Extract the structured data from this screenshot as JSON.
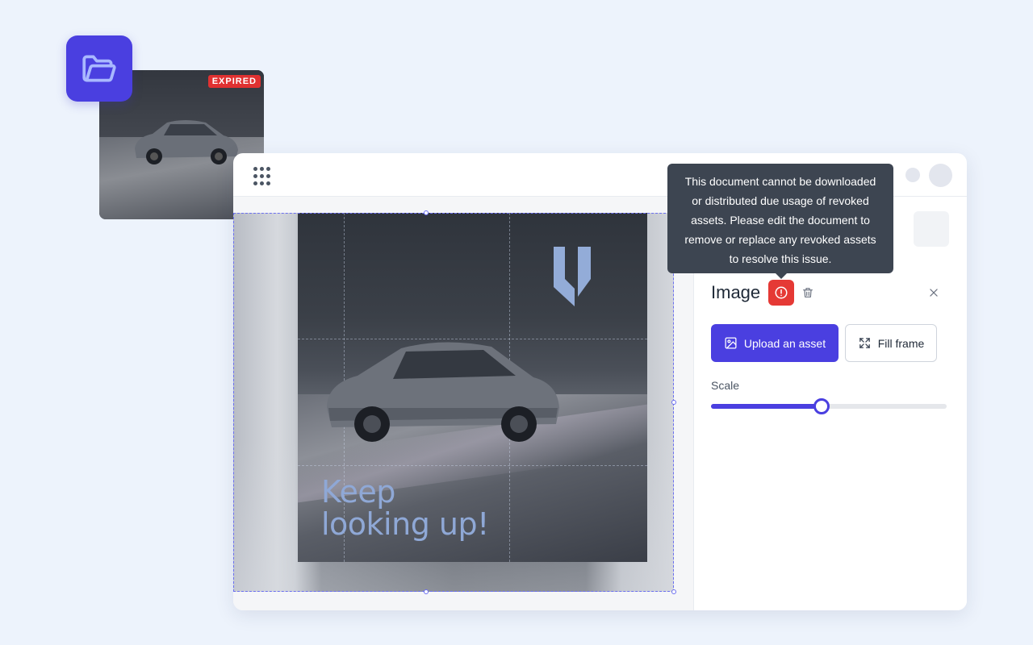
{
  "thumbnail": {
    "badge": "EXPIRED"
  },
  "canvas": {
    "headline_line1": "Keep",
    "headline_line2": "looking up!"
  },
  "panel": {
    "title": "Image",
    "upload_label": "Upload an asset",
    "fill_label": "Fill frame",
    "scale_label": "Scale",
    "scale_value": 0.47
  },
  "tooltip": {
    "text": "This document cannot be downloaded or distributed due usage of revoked assets.  Please edit the document to remove or replace any revoked assets to resolve this issue."
  },
  "colors": {
    "accent": "#4a3fe0",
    "danger": "#e53935",
    "tooltip_bg": "#3d4551"
  },
  "icons": [
    "folder-icon",
    "apps-grid-icon",
    "alert-circle-icon",
    "trash-icon",
    "close-icon",
    "image-icon",
    "expand-icon"
  ]
}
